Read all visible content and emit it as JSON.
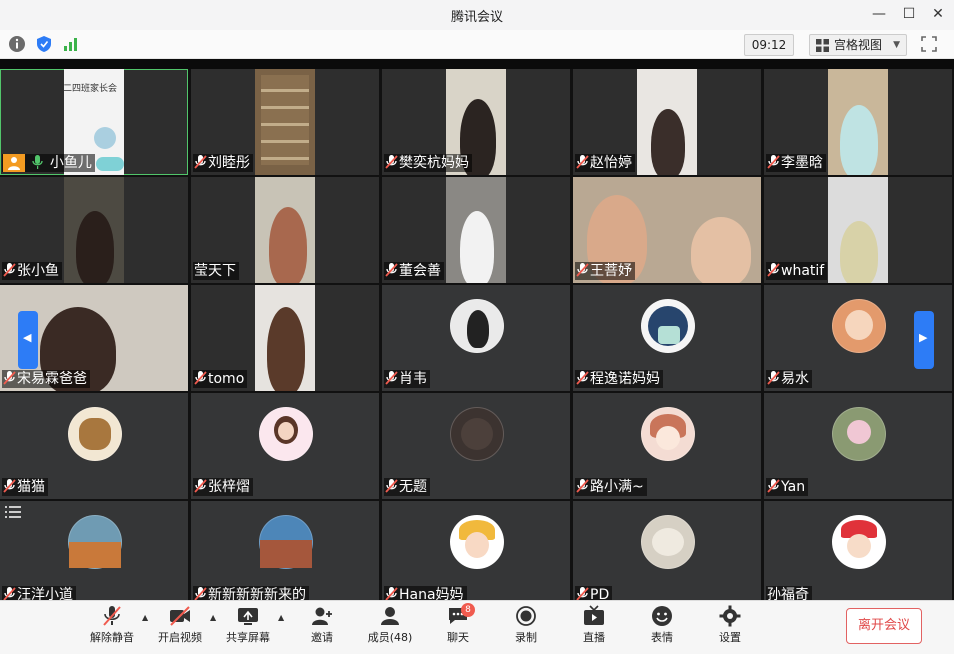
{
  "window": {
    "title": "腾讯会议",
    "minimize_glyph": "—",
    "maximize_glyph": "☐",
    "close_glyph": "✕"
  },
  "toolbar": {
    "clock": "09:12",
    "view_label": "宫格视图",
    "icons": [
      "info-icon",
      "shield-icon",
      "signal-icon",
      "fullscreen-icon"
    ]
  },
  "participants": [
    {
      "name": "小鱼儿",
      "host": true
    },
    {
      "name": "刘睦彤"
    },
    {
      "name": "樊奕杭妈妈"
    },
    {
      "name": "赵怡婷"
    },
    {
      "name": "李墨晗"
    },
    {
      "name": "张小鱼"
    },
    {
      "name": "莹天下"
    },
    {
      "name": "董会善"
    },
    {
      "name": "王菩妤"
    },
    {
      "name": "whatif"
    },
    {
      "name": "宋易霖爸爸"
    },
    {
      "name": "tomo"
    },
    {
      "name": "肖韦"
    },
    {
      "name": "程逸诺妈妈"
    },
    {
      "name": "易水"
    },
    {
      "name": "猫猫"
    },
    {
      "name": "张梓熠"
    },
    {
      "name": "无题"
    },
    {
      "name": "路小满~"
    },
    {
      "name": "Yan"
    },
    {
      "name": "汪洋小道"
    },
    {
      "name": "新新新新新来的"
    },
    {
      "name": "Hana妈妈"
    },
    {
      "name": "PD"
    },
    {
      "name": "孙福奇"
    }
  ],
  "first_tile_caption": "二四班家长会",
  "bottombar": {
    "unmute": "解除静音",
    "start_video": "开启视频",
    "share_screen": "共享屏幕",
    "invite": "邀请",
    "members": "成员(48)",
    "chat": "聊天",
    "chat_badge": "8",
    "record": "录制",
    "live": "直播",
    "reactions": "表情",
    "settings": "设置",
    "leave": "离开会议"
  },
  "colors": {
    "accent_blue": "#2d7cf6",
    "leave_red": "#e04848",
    "active_speaker_green": "#52c56b"
  }
}
